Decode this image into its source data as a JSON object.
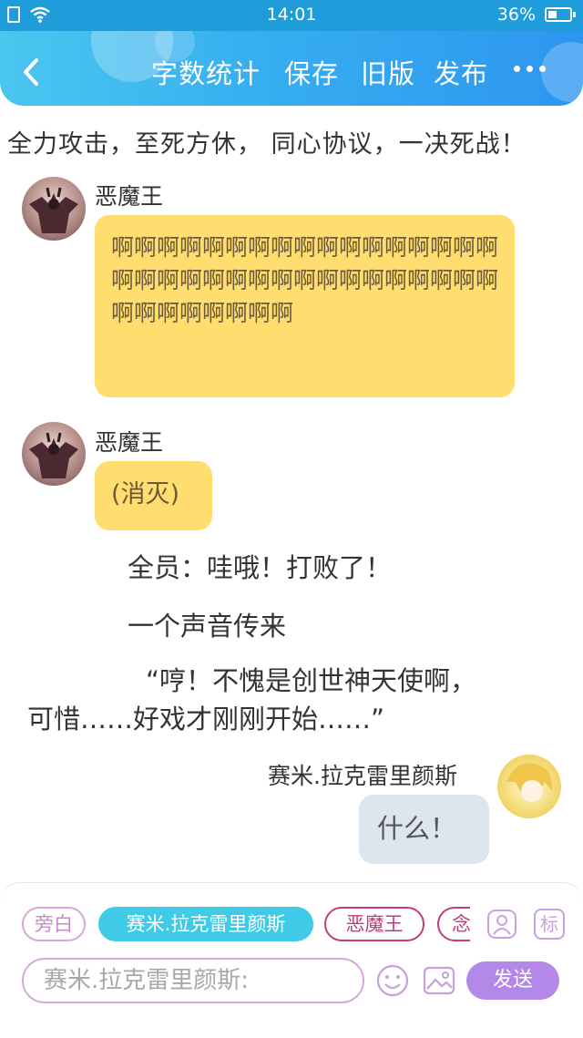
{
  "status_bar": {
    "time": "14:01",
    "battery": "36%",
    "battery_level": 0.36
  },
  "header": {
    "actions": [
      "字数统计",
      "保存",
      "旧版",
      "发布"
    ],
    "icons": {
      "back": "chevron-left-icon",
      "more": "more-dots-icon"
    }
  },
  "chat": {
    "top_line": "全力攻击，至死方休， 同心协议，一决死战！",
    "messages": [
      {
        "speaker": "恶魔王",
        "side": "left",
        "text": "啊啊啊啊啊啊啊啊啊啊啊啊啊啊啊啊啊啊啊啊啊啊啊啊啊啊啊啊啊啊啊啊啊啊啊啊啊啊啊啊啊啊"
      },
      {
        "speaker": "恶魔王",
        "side": "left",
        "text": "(消灭)"
      }
    ],
    "narration": [
      "全员：哇哦！打败了！",
      "一个声音传来",
      "“哼！不愧是创世神天使啊，",
      "可惜……好戏才刚刚开始……”"
    ],
    "right_message": {
      "speaker": "赛米.拉克雷里颜斯",
      "side": "right",
      "text": "什么！"
    }
  },
  "composer": {
    "chips": [
      "旁白",
      "赛米.拉克雷里颜斯",
      "恶魔王",
      "念"
    ],
    "input_placeholder": "赛米.拉克雷里颜斯:",
    "tag_button_label": "标",
    "send_label": "发送"
  },
  "colors": {
    "header_start": "#4bc6ef",
    "header_end": "#2d96f0",
    "bubble_left": "#ffdd6e",
    "bubble_right": "#dde6ee",
    "chip_active": "#3fcbe8",
    "send_button": "#b488e8"
  }
}
